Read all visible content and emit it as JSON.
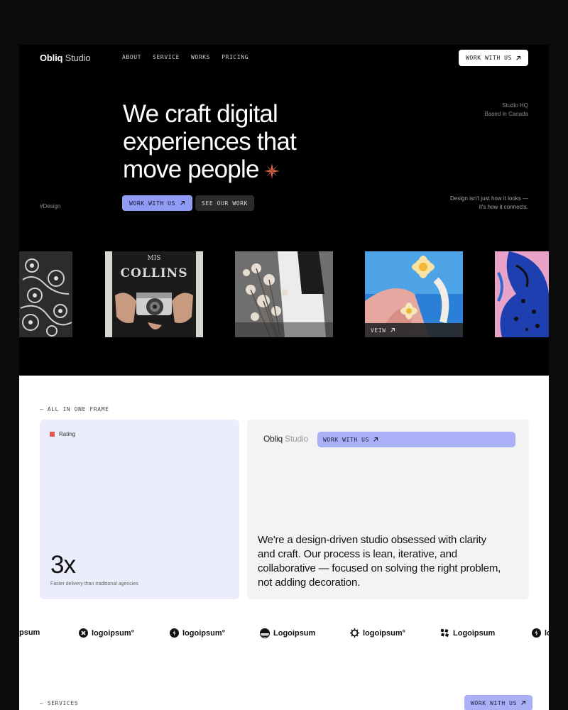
{
  "brand": {
    "name_bold": "Obliq",
    "name_light": "Studio"
  },
  "nav": {
    "items": [
      "ABOUT",
      "SERVICE",
      "WORKS",
      "PRICING"
    ]
  },
  "header": {
    "cta_label": "WORK WITH US"
  },
  "hero": {
    "headline": [
      "We craft digital",
      "experiences that",
      "move people"
    ],
    "location": [
      "Studio HQ",
      "Based in Canada"
    ],
    "primary_label": "WORK WITH US",
    "secondary_label": "SEE OUR WORK",
    "tag": "#Design",
    "tagline": [
      "Design isn't just how it looks —",
      "it's how it connects."
    ],
    "view_label": "VEIW"
  },
  "frame": {
    "section_label": "— ALL IN ONE FRAME",
    "rating_label": "Rating",
    "stat_value": "3x",
    "stat_caption": "Faster delivery than traditional agencies",
    "mini_brand_bold": "Obliq",
    "mini_brand_light": "Studio",
    "mini_cta": "WORK WITH US",
    "about_text": "We're a design-driven studio obsessed with clarity and craft. Our process is lean, iterative, and collaborative — focused on solving the right problem, not adding decoration."
  },
  "logos": {
    "items": [
      "psum",
      "logoipsum°",
      "logoipsum°",
      "Logoipsum",
      "logoipsum°",
      "Logoipsum",
      "lo"
    ]
  },
  "services": {
    "label": "— SERVICES",
    "cta_label": "WORK WITH US"
  },
  "colors": {
    "accent": "#8f9bf4",
    "accent_light": "#a9b0f6",
    "rating_square": "#e2554a",
    "star": "#f26a4b",
    "card_tint": "#ecedfc"
  }
}
